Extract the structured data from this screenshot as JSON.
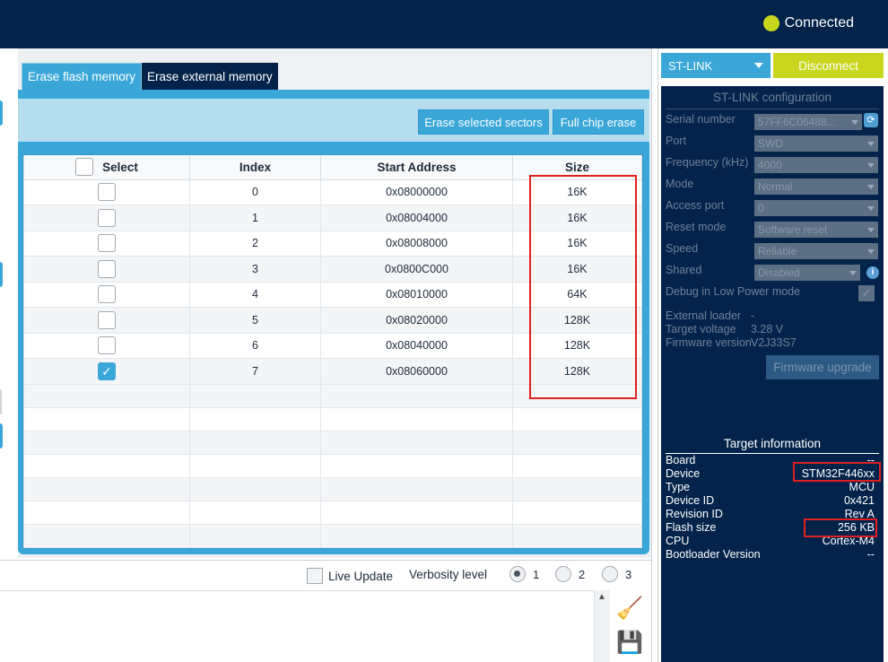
{
  "header": {
    "status": "Connected",
    "status_color": "#c8d71e"
  },
  "tabs": [
    {
      "label": "Erase flash memory",
      "active": true
    },
    {
      "label": "Erase external memory",
      "active": false
    }
  ],
  "toolbar": {
    "erase_selected": "Erase selected sectors",
    "full_chip": "Full chip erase"
  },
  "table": {
    "columns": [
      "Select",
      "Index",
      "Start Address",
      "Size"
    ],
    "rows": [
      {
        "checked": false,
        "index": "0",
        "address": "0x08000000",
        "size": "16K"
      },
      {
        "checked": false,
        "index": "1",
        "address": "0x08004000",
        "size": "16K"
      },
      {
        "checked": false,
        "index": "2",
        "address": "0x08008000",
        "size": "16K"
      },
      {
        "checked": false,
        "index": "3",
        "address": "0x0800C000",
        "size": "16K"
      },
      {
        "checked": false,
        "index": "4",
        "address": "0x08010000",
        "size": "64K"
      },
      {
        "checked": false,
        "index": "5",
        "address": "0x08020000",
        "size": "128K"
      },
      {
        "checked": false,
        "index": "6",
        "address": "0x08040000",
        "size": "128K"
      },
      {
        "checked": true,
        "index": "7",
        "address": "0x08060000",
        "size": "128K"
      }
    ]
  },
  "log": {
    "live_update": "Live Update",
    "verbosity": "Verbosity level",
    "levels": [
      "1",
      "2",
      "3"
    ]
  },
  "probe": {
    "interface": "ST-LINK",
    "disconnect": "Disconnect"
  },
  "config": {
    "title": "ST-LINK configuration",
    "serial_label": "Serial number",
    "serial": "57FF6C06488...",
    "port_label": "Port",
    "port": "SWD",
    "freq_label": "Frequency (kHz)",
    "freq": "4000",
    "mode_label": "Mode",
    "mode": "Normal",
    "access_label": "Access port",
    "access": "0",
    "reset_label": "Reset mode",
    "reset": "Software reset",
    "speed_label": "Speed",
    "speed": "Reliable",
    "shared_label": "Shared",
    "shared": "Disabled",
    "lowpower_label": "Debug in Low Power mode",
    "loader_label": "External loader",
    "loader": "-",
    "voltage_label": "Target voltage",
    "voltage": "3.28 V",
    "fw_label": "Firmware version",
    "fw": "V2J33S7",
    "fw_upgrade": "Firmware upgrade"
  },
  "target": {
    "title": "Target information",
    "board_label": "Board",
    "board": "--",
    "device_label": "Device",
    "device": "STM32F446xx",
    "type_label": "Type",
    "type": "MCU",
    "devid_label": "Device ID",
    "devid": "0x421",
    "rev_label": "Revision ID",
    "rev": "Rev A",
    "flash_label": "Flash size",
    "flash": "256 KB",
    "cpu_label": "CPU",
    "cpu": "Cortex-M4",
    "boot_label": "Bootloader Version",
    "boot": "--"
  }
}
